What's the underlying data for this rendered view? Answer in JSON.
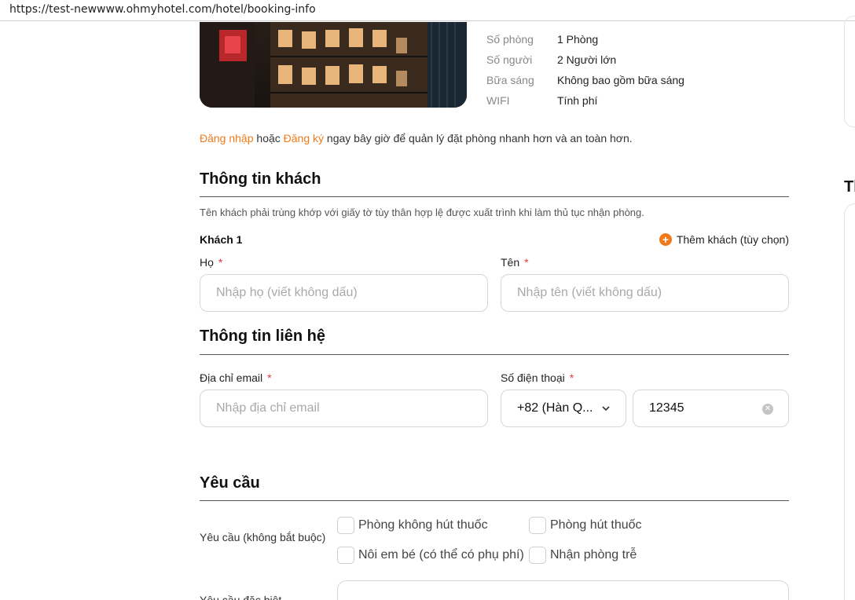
{
  "browser": {
    "url": "https://test-newwww.ohmyhotel.com/hotel/booking-info"
  },
  "room_info": [
    {
      "key": "Số phòng",
      "value": "1 Phòng"
    },
    {
      "key": "Số người",
      "value": "2 Người lớn"
    },
    {
      "key": "Bữa sáng",
      "value": "Không bao gồm bữa sáng"
    },
    {
      "key": "WIFI",
      "value": "Tính phí"
    }
  ],
  "login_prompt": {
    "login_link": "Đăng nhập",
    "or": " hoặc ",
    "register_link": "Đăng ký",
    "rest": " ngay bây giờ để quản lý đặt phòng nhanh hơn và an toàn hơn."
  },
  "guest_section": {
    "title": "Thông tin khách",
    "note": "Tên khách phải trùng khớp với giấy tờ tùy thân hợp lệ được xuất trình khi làm thủ tục nhận phòng.",
    "guest_label": "Khách 1",
    "add_guest": "Thêm khách (tùy chọn)",
    "last_name_label": "Họ",
    "last_name_placeholder": "Nhập họ (viết không dấu)",
    "first_name_label": "Tên",
    "first_name_placeholder": "Nhập tên (viết không dấu)",
    "required_mark": "*"
  },
  "contact_section": {
    "title": "Thông tin liên hệ",
    "email_label": "Địa chỉ email",
    "email_placeholder": "Nhập địa chỉ email",
    "phone_label": "Số điện thoại",
    "country_code": "+82 (Hàn Q...",
    "phone_value": "12345",
    "required_mark": "*"
  },
  "request_section": {
    "title": "Yêu cầu",
    "optional_label": "Yêu cầu (không bắt buộc)",
    "options": [
      {
        "label": "Phòng không hút thuốc",
        "checked": false
      },
      {
        "label": "Phòng hút thuốc",
        "checked": false
      },
      {
        "label": "Nôi em bé (có thể có phụ phí)",
        "checked": false
      },
      {
        "label": "Nhận phòng trễ",
        "checked": false
      }
    ],
    "special_label": "Yêu cầu đặc biệt"
  },
  "sidebar": {
    "title_fragment": "Th"
  },
  "colors": {
    "accent": "#f27a1a",
    "required": "#e53935"
  }
}
